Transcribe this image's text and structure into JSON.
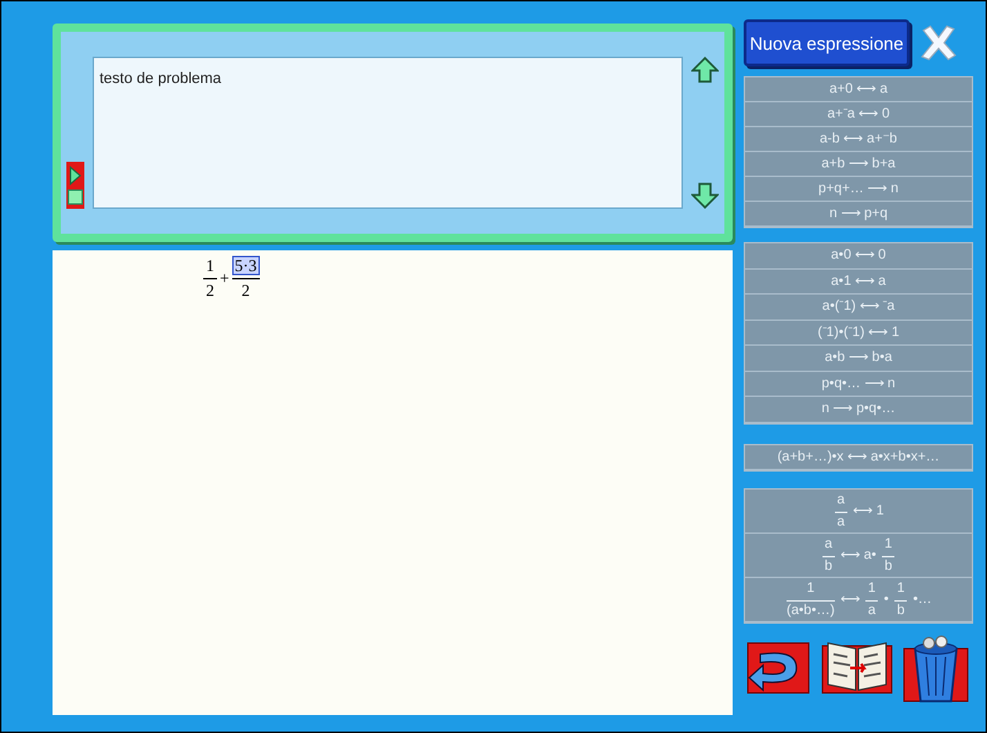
{
  "problem": {
    "text": "testo de problema"
  },
  "expression": [
    {
      "kind": "frac",
      "num": "1",
      "den": "2",
      "selected": false
    },
    {
      "kind": "op",
      "text": "+"
    },
    {
      "kind": "frac",
      "num": "5·3",
      "den": "2",
      "selected": true
    }
  ],
  "new_button": "Nuova espressione",
  "rule_groups": [
    {
      "rules": [
        {
          "kind": "text",
          "text": "a+0 ⟷ a"
        },
        {
          "kind": "text",
          "text": "a+⁻a ⟷ 0"
        },
        {
          "kind": "text",
          "text": "a-b ⟷ a+⁻b"
        },
        {
          "kind": "text",
          "text": "a+b ⟶ b+a"
        },
        {
          "kind": "text",
          "text": "p+q+… ⟶ n"
        },
        {
          "kind": "text",
          "text": "n ⟶ p+q"
        }
      ]
    },
    {
      "rules": [
        {
          "kind": "text",
          "text": "a•0 ⟷ 0"
        },
        {
          "kind": "text",
          "text": "a•1 ⟷ a"
        },
        {
          "kind": "text",
          "text": "a•(⁻1) ⟷ ⁻a"
        },
        {
          "kind": "text",
          "text": "(⁻1)•(⁻1) ⟷ 1"
        },
        {
          "kind": "text",
          "text": "a•b ⟶ b•a"
        },
        {
          "kind": "text",
          "text": "p•q•… ⟶ n"
        },
        {
          "kind": "text",
          "text": "n ⟶ p•q•…"
        }
      ]
    },
    {
      "rules": [
        {
          "kind": "text",
          "text": "(a+b+…)•x ⟷ a•x+b•x+…"
        }
      ]
    },
    {
      "rules": [
        {
          "kind": "fraction",
          "parts": [
            {
              "kind": "frac",
              "num": "a",
              "den": "a"
            },
            {
              "kind": "text",
              "text": "⟷ 1"
            }
          ]
        },
        {
          "kind": "fraction",
          "parts": [
            {
              "kind": "frac",
              "num": "a",
              "den": "b"
            },
            {
              "kind": "text",
              "text": "⟷ a•"
            },
            {
              "kind": "frac",
              "num": "1",
              "den": "b"
            }
          ]
        },
        {
          "kind": "fraction",
          "parts": [
            {
              "kind": "frac",
              "num": "1",
              "den": "(a•b•…)"
            },
            {
              "kind": "text",
              "text": "⟷"
            },
            {
              "kind": "frac",
              "num": "1",
              "den": "a"
            },
            {
              "kind": "text",
              "text": "•"
            },
            {
              "kind": "frac",
              "num": "1",
              "den": "b"
            },
            {
              "kind": "text",
              "text": "•…"
            }
          ]
        }
      ]
    }
  ]
}
